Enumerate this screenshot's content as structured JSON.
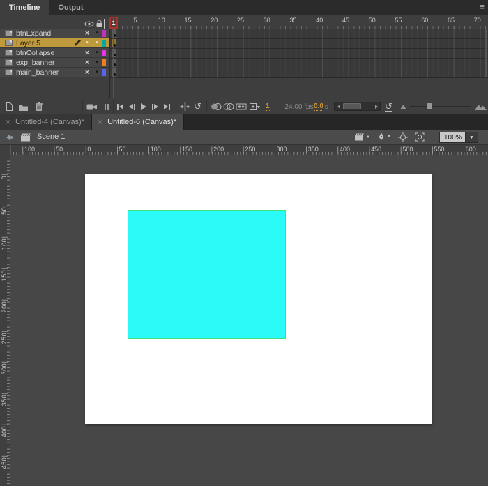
{
  "icons": {
    "panel_menu": "≡",
    "loop": "↺",
    "reset_zoom": "↺",
    "close_tab": "×",
    "dropdown_caret": "▼",
    "layer_hidden_mark": "×",
    "layer_dot": "•",
    "svg_icons": [
      "eye-icon",
      "lock-icon",
      "outline-square-icon",
      "new-layer-icon",
      "new-folder-icon",
      "trash-icon",
      "camera-icon",
      "bars-icon",
      "first-frame-icon",
      "step-back-icon",
      "play-icon",
      "step-forward-icon",
      "last-frame-icon",
      "center-frame-icon",
      "onion-skin-icon",
      "onion-skin-outlines-icon",
      "edit-multiple-frames-icon",
      "modify-markers-icon",
      "small-frame-icon",
      "large-frame-mountains-icon",
      "back-arrow-icon",
      "clapperboard-icon",
      "edit-symbols-icon",
      "center-stage-crosshair-icon",
      "clip-content-icon",
      "pencil-icon"
    ]
  },
  "panel_tabs": [
    {
      "label": "Timeline",
      "active": true
    },
    {
      "label": "Output",
      "active": false
    }
  ],
  "timeline": {
    "current_frame": "1",
    "frame_labels": [
      5,
      10,
      15,
      20,
      25,
      30,
      35,
      40,
      45,
      50,
      55,
      60,
      65,
      70
    ],
    "layers": [
      {
        "name": "btnExpand",
        "selected": false,
        "color": "#c22fc2"
      },
      {
        "name": "Layer 5",
        "selected": true,
        "color": "#00ad9d"
      },
      {
        "name": "btnCollapse",
        "selected": false,
        "color": "#e833e8"
      },
      {
        "name": "exp_banner",
        "selected": false,
        "color": "#ee7d20"
      },
      {
        "name": "main_banner",
        "selected": false,
        "color": "#5964f0"
      }
    ],
    "status": {
      "frame_rate": "24.00 fps",
      "time_value": "0.0",
      "time_unit": "s"
    }
  },
  "document_tabs": [
    {
      "label": "Untitled-4 (Canvas)*",
      "active": false
    },
    {
      "label": "Untitled-6 (Canvas)*",
      "active": true
    }
  ],
  "edit_bar": {
    "scene_label": "Scene 1",
    "zoom_value": "100%"
  },
  "rulers": {
    "horizontal_labels": [
      "100",
      "50",
      "0",
      "50",
      "100",
      "150",
      "200",
      "250",
      "300",
      "350",
      "400",
      "450",
      "500",
      "550",
      "600"
    ],
    "vertical_labels": [
      "0",
      "50",
      "100",
      "150",
      "200",
      "250",
      "300",
      "350",
      "400",
      "450"
    ]
  },
  "stage": {
    "background": "#ffffff"
  },
  "shape": {
    "fill": "#2bfbf8",
    "stroke": "#3fe17a"
  }
}
